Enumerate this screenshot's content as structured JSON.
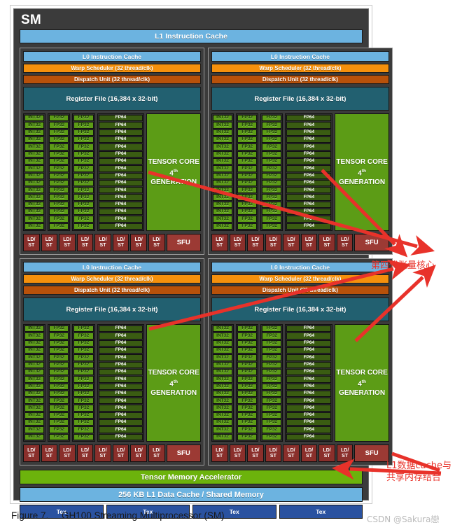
{
  "figure": {
    "caption_label": "Figure 7.",
    "caption_text": "GH100 Streaming Multiprocessor (SM)",
    "watermark": "CSDN @Sakura戀"
  },
  "sm": {
    "title": "SM",
    "l1_instruction_cache": "L1 Instruction Cache",
    "processing_blocks": [
      {
        "l0_instruction_cache": "L0 Instruction Cache",
        "warp_scheduler": "Warp Scheduler (32 thread/clk)",
        "dispatch_unit": "Dispatch Unit (32 thread/clk)",
        "register_file": "Register File (16,384 x 32-bit)",
        "int32_label": "INT32",
        "fp32_label": "FP32",
        "fp64_label": "FP64",
        "core_rows": 16,
        "tensor_core_line1": "TENSOR CORE",
        "tensor_core_line2_num": "4",
        "tensor_core_line2_sup": "th",
        "tensor_core_line2_rest": " GENERATION",
        "ldst_label_top": "LD/",
        "ldst_label_bottom": "ST",
        "ldst_count": 8,
        "sfu_label": "SFU"
      },
      {
        "l0_instruction_cache": "L0 Instruction Cache",
        "warp_scheduler": "Warp Scheduler (32 thread/clk)",
        "dispatch_unit": "Dispatch Unit (32 thread/clk)",
        "register_file": "Register File (16,384 x 32-bit)",
        "int32_label": "INT32",
        "fp32_label": "FP32",
        "fp64_label": "FP64",
        "core_rows": 16,
        "tensor_core_line1": "TENSOR CORE",
        "tensor_core_line2_num": "4",
        "tensor_core_line2_sup": "th",
        "tensor_core_line2_rest": " GENERATION",
        "ldst_label_top": "LD/",
        "ldst_label_bottom": "ST",
        "ldst_count": 8,
        "sfu_label": "SFU"
      },
      {
        "l0_instruction_cache": "L0 Instruction Cache",
        "warp_scheduler": "Warp Scheduler (32 thread/clk)",
        "dispatch_unit": "Dispatch Unit (32 thread/clk)",
        "register_file": "Register File (16,384 x 32-bit)",
        "int32_label": "INT32",
        "fp32_label": "FP32",
        "fp64_label": "FP64",
        "core_rows": 16,
        "tensor_core_line1": "TENSOR CORE",
        "tensor_core_line2_num": "4",
        "tensor_core_line2_sup": "th",
        "tensor_core_line2_rest": " GENERATION",
        "ldst_label_top": "LD/",
        "ldst_label_bottom": "ST",
        "ldst_count": 8,
        "sfu_label": "SFU"
      },
      {
        "l0_instruction_cache": "L0 Instruction Cache",
        "warp_scheduler": "Warp Scheduler (32 thread/clk)",
        "dispatch_unit": "Dispatch Unit (32 thread/clk)",
        "register_file": "Register File (16,384 x 32-bit)",
        "int32_label": "INT32",
        "fp32_label": "FP32",
        "fp64_label": "FP64",
        "core_rows": 16,
        "tensor_core_line1": "TENSOR CORE",
        "tensor_core_line2_num": "4",
        "tensor_core_line2_sup": "th",
        "tensor_core_line2_rest": " GENERATION",
        "ldst_label_top": "LD/",
        "ldst_label_bottom": "ST",
        "ldst_count": 8,
        "sfu_label": "SFU"
      }
    ],
    "tensor_memory_accelerator": "Tensor Memory Accelerator",
    "l1_data_cache": "256 KB L1 Data Cache / Shared Memory",
    "tex_label": "Tex",
    "tex_count": 4
  },
  "annotations": [
    {
      "id": "tensor",
      "text": "第四代张量核心"
    },
    {
      "id": "l1",
      "text": "L1数据cache与\n共享内存结合"
    }
  ],
  "colors": {
    "chip_background": "#3b3b3b",
    "instruction_cache": "#6cb3e0",
    "warp_scheduler": "#f5900c",
    "dispatch_unit": "#b8510a",
    "register_file": "#226070",
    "core_green": "#5c9c16",
    "fp64_green": "#3a5c12",
    "ldst_red": "#8a2f2b",
    "sfu_red": "#9c3a34",
    "tma_green": "#6cb30c",
    "tex_blue": "#2a52a0",
    "annotation_red": "#e8322a"
  }
}
